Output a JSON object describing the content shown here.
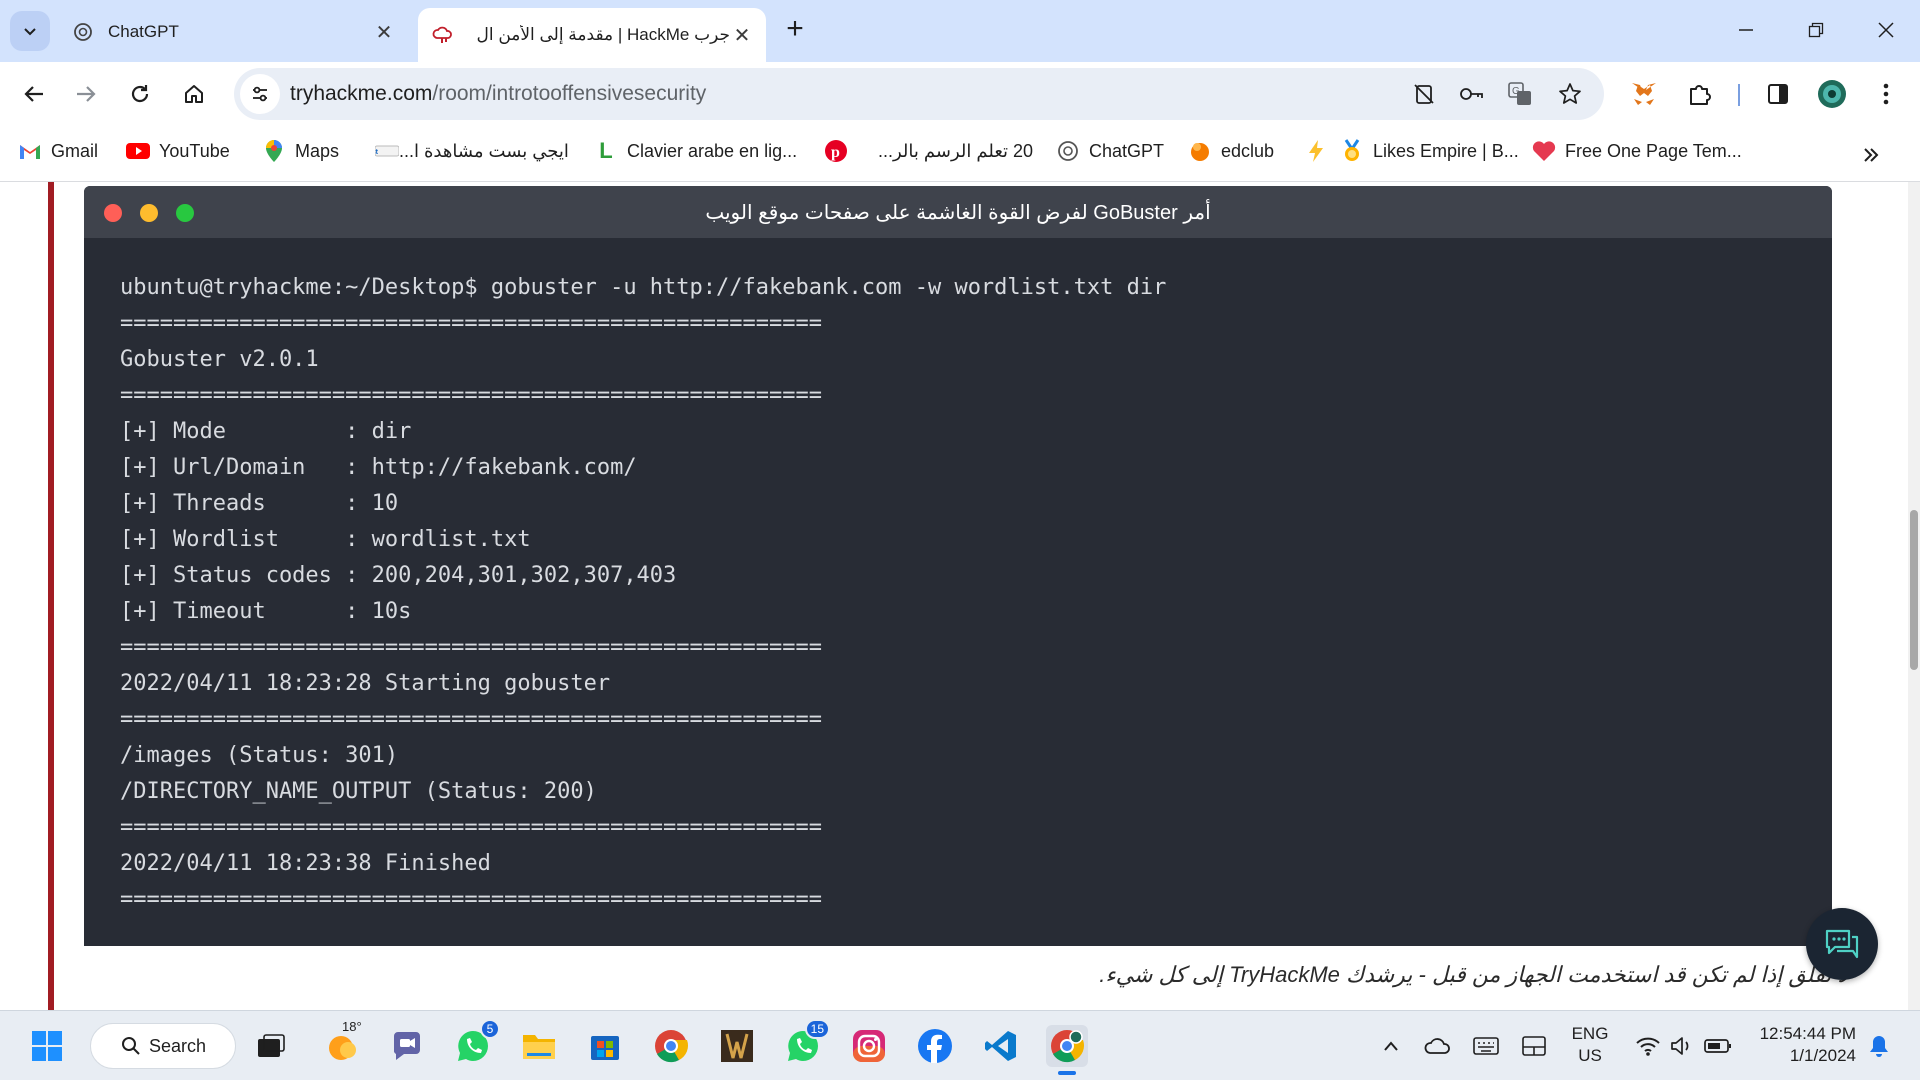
{
  "tabs": [
    {
      "title": "ChatGPT",
      "active": false
    },
    {
      "title": "جرب HackMe | مقدمة إلى الأمن ال",
      "active": true
    }
  ],
  "toolbar": {
    "url_host": "tryhackme.com",
    "url_path": "/room/introtooffensivesecurity"
  },
  "bookmarks": [
    {
      "label": "Gmail",
      "icon": "gmail-icon"
    },
    {
      "label": "YouTube",
      "icon": "youtube-icon"
    },
    {
      "label": "Maps",
      "icon": "maps-icon"
    },
    {
      "label": "ايجي بست مشاهدة ا...",
      "icon": "egybest-icon"
    },
    {
      "label": "Clavier arabe en lig...",
      "icon": "clavier-icon"
    },
    {
      "label": "",
      "icon": "pinterest-icon"
    },
    {
      "label": "20 تعلم الرسم بالر...",
      "icon": "drawing-icon"
    },
    {
      "label": "ChatGPT",
      "icon": "chatgpt-icon"
    },
    {
      "label": "edclub",
      "icon": "edclub-icon"
    },
    {
      "label": "",
      "icon": "lightning-icon"
    },
    {
      "label": "Likes Empire | B...",
      "icon": "medal-icon"
    },
    {
      "label": "Free One Page Tem...",
      "icon": "heart-icon"
    }
  ],
  "terminal": {
    "title": "أمر GoBuster لفرض القوة الغاشمة على صفحات موقع الويب",
    "lines": [
      "ubuntu@tryhackme:~/Desktop$ gobuster -u http://fakebank.com -w wordlist.txt dir",
      "=====================================================",
      "Gobuster v2.0.1",
      "=====================================================",
      "[+] Mode         : dir",
      "[+] Url/Domain   : http://fakebank.com/",
      "[+] Threads      : 10",
      "[+] Wordlist     : wordlist.txt",
      "[+] Status codes : 200,204,301,302,307,403",
      "[+] Timeout      : 10s",
      "=====================================================",
      "2022/04/11 18:23:28 Starting gobuster",
      "=====================================================",
      "/images (Status: 301)",
      "/DIRECTORY_NAME_OUTPUT (Status: 200)",
      "=====================================================",
      "2022/04/11 18:23:38 Finished",
      "====================================================="
    ]
  },
  "page_text": "لا تقلق إذا لم تكن قد استخدمت الجهاز من قبل - يرشدك TryHackMe إلى كل شيء.",
  "taskbar": {
    "search_label": "Search",
    "weather_temp": "18°",
    "whatsapp_badge": "5",
    "whatsapp2_badge": "15",
    "lang_line1": "ENG",
    "lang_line2": "US",
    "time": "12:54:44 PM",
    "date": "1/1/2024"
  },
  "colors": {
    "tabstrip": "#d3e3fd",
    "terminal_bg": "#282c35",
    "terminal_header": "#3f434c",
    "accent_bar": "#a11c23",
    "dot_red": "#ff5f57",
    "dot_yellow": "#febc2e",
    "dot_green": "#28c840"
  }
}
